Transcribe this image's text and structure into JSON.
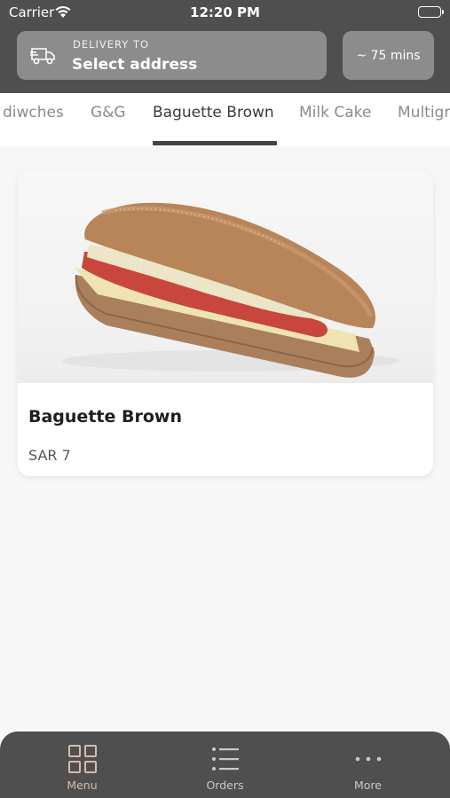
{
  "status_bar": {
    "carrier": "Carrier",
    "time": "12:20 PM"
  },
  "header": {
    "delivery_label": "DELIVERY TO",
    "address": "Select address",
    "eta": "~ 75 mins"
  },
  "categories": {
    "items": [
      "diwches",
      "G&G",
      "Baguette Brown",
      "Milk Cake",
      "Multigr"
    ],
    "active": "Baguette Brown"
  },
  "product": {
    "name": "Baguette Brown",
    "price": "SAR 7"
  },
  "bottom_nav": {
    "items": [
      {
        "label": "Menu",
        "icon": "grid-icon",
        "active": true
      },
      {
        "label": "Orders",
        "icon": "list-icon",
        "active": false
      },
      {
        "label": "More",
        "icon": "more-dots-icon",
        "active": false
      }
    ]
  },
  "colors": {
    "header_bg": "#4f4f4f",
    "button_bg": "#8c8c8c",
    "accent": "#d9b9ac"
  }
}
